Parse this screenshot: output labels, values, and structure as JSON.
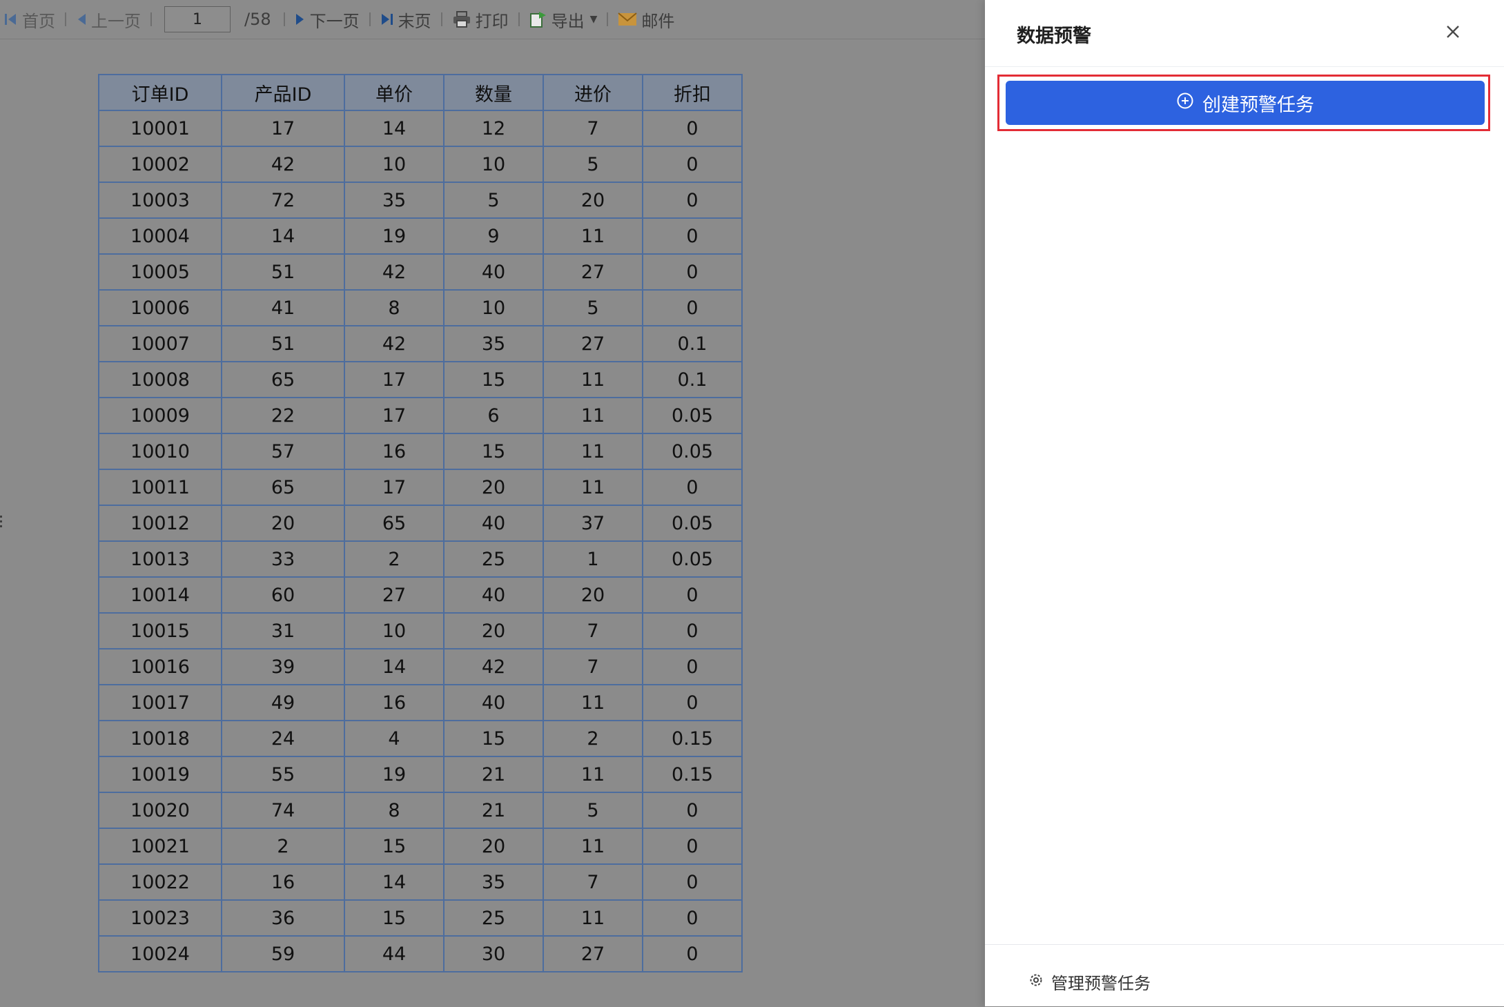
{
  "toolbar": {
    "first_label": "首页",
    "prev_label": "上一页",
    "page_current": "1",
    "page_total": "/58",
    "next_label": "下一页",
    "last_label": "末页",
    "print_label": "打印",
    "export_label": "导出",
    "mail_label": "邮件"
  },
  "table": {
    "headers": [
      "订单ID",
      "产品ID",
      "单价",
      "数量",
      "进价",
      "折扣"
    ],
    "rows": [
      [
        "10001",
        "17",
        "14",
        "12",
        "7",
        "0"
      ],
      [
        "10002",
        "42",
        "10",
        "10",
        "5",
        "0"
      ],
      [
        "10003",
        "72",
        "35",
        "5",
        "20",
        "0"
      ],
      [
        "10004",
        "14",
        "19",
        "9",
        "11",
        "0"
      ],
      [
        "10005",
        "51",
        "42",
        "40",
        "27",
        "0"
      ],
      [
        "10006",
        "41",
        "8",
        "10",
        "5",
        "0"
      ],
      [
        "10007",
        "51",
        "42",
        "35",
        "27",
        "0.1"
      ],
      [
        "10008",
        "65",
        "17",
        "15",
        "11",
        "0.1"
      ],
      [
        "10009",
        "22",
        "17",
        "6",
        "11",
        "0.05"
      ],
      [
        "10010",
        "57",
        "16",
        "15",
        "11",
        "0.05"
      ],
      [
        "10011",
        "65",
        "17",
        "20",
        "11",
        "0"
      ],
      [
        "10012",
        "20",
        "65",
        "40",
        "37",
        "0.05"
      ],
      [
        "10013",
        "33",
        "2",
        "25",
        "1",
        "0.05"
      ],
      [
        "10014",
        "60",
        "27",
        "40",
        "20",
        "0"
      ],
      [
        "10015",
        "31",
        "10",
        "20",
        "7",
        "0"
      ],
      [
        "10016",
        "39",
        "14",
        "42",
        "7",
        "0"
      ],
      [
        "10017",
        "49",
        "16",
        "40",
        "11",
        "0"
      ],
      [
        "10018",
        "24",
        "4",
        "15",
        "2",
        "0.15"
      ],
      [
        "10019",
        "55",
        "19",
        "21",
        "11",
        "0.15"
      ],
      [
        "10020",
        "74",
        "8",
        "21",
        "5",
        "0"
      ],
      [
        "10021",
        "2",
        "15",
        "20",
        "11",
        "0"
      ],
      [
        "10022",
        "16",
        "14",
        "35",
        "7",
        "0"
      ],
      [
        "10023",
        "36",
        "15",
        "25",
        "11",
        "0"
      ],
      [
        "10024",
        "59",
        "44",
        "30",
        "27",
        "0"
      ]
    ]
  },
  "panel": {
    "title": "数据预警",
    "create_button_label": "创建预警任务",
    "manage_label": "管理预警任务"
  },
  "colors": {
    "primary": "#2d62e0",
    "highlight": "#e32c35",
    "overlay": "#8b8b8b",
    "table_border": "#4d6d9e"
  },
  "icons": {
    "first": "first-page-icon",
    "prev": "prev-page-icon",
    "next": "next-page-icon",
    "last": "last-page-icon",
    "print": "printer-icon",
    "export": "export-icon",
    "mail": "mail-icon",
    "close": "close-icon",
    "create": "plus-circle-icon",
    "manage": "gear-icon"
  }
}
